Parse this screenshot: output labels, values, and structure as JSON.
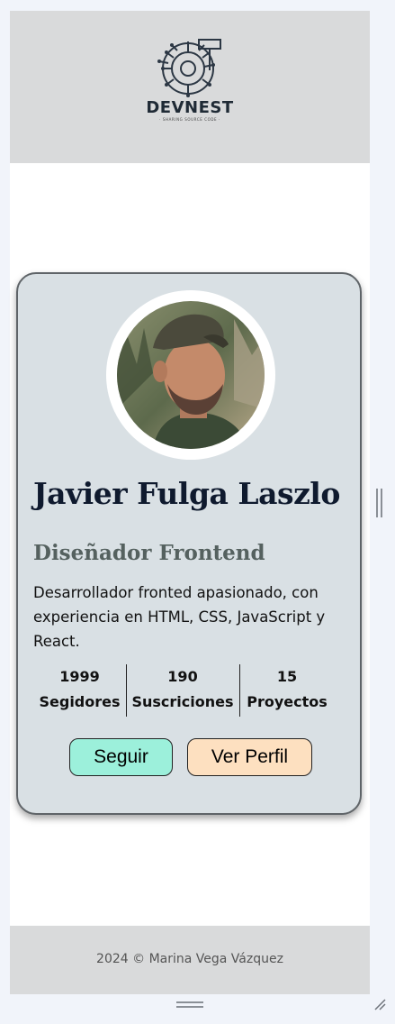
{
  "header": {
    "logo_name": "DEVNEST",
    "logo_tagline": "· SHARING SOURCE CODE ·"
  },
  "profile": {
    "name": "Javier Fulga Laszlo",
    "role": "Diseñador Frontend",
    "bio": "Desarrollador fronted apasionado, con experiencia en HTML, CSS, JavaScript y React.",
    "stats": [
      {
        "value": "1999",
        "label": "Segidores"
      },
      {
        "value": "190",
        "label": "Suscriciones"
      },
      {
        "value": "15",
        "label": "Proyectos"
      }
    ],
    "buttons": {
      "follow": "Seguir",
      "profile": "Ver Perfil"
    }
  },
  "footer": {
    "text": "2024 © Marina Vega Vázquez"
  },
  "colors": {
    "header_bg": "#d9dadb",
    "card_bg": "#d9e0e4",
    "follow_button": "#9cf0db",
    "profile_button": "#fde0c0",
    "name_color": "#0f1a2e",
    "role_color": "#55615f"
  },
  "icons": [
    "devnest-logo-icon",
    "avatar-photo",
    "scrollbar-handle",
    "resize-grip-icon"
  ]
}
